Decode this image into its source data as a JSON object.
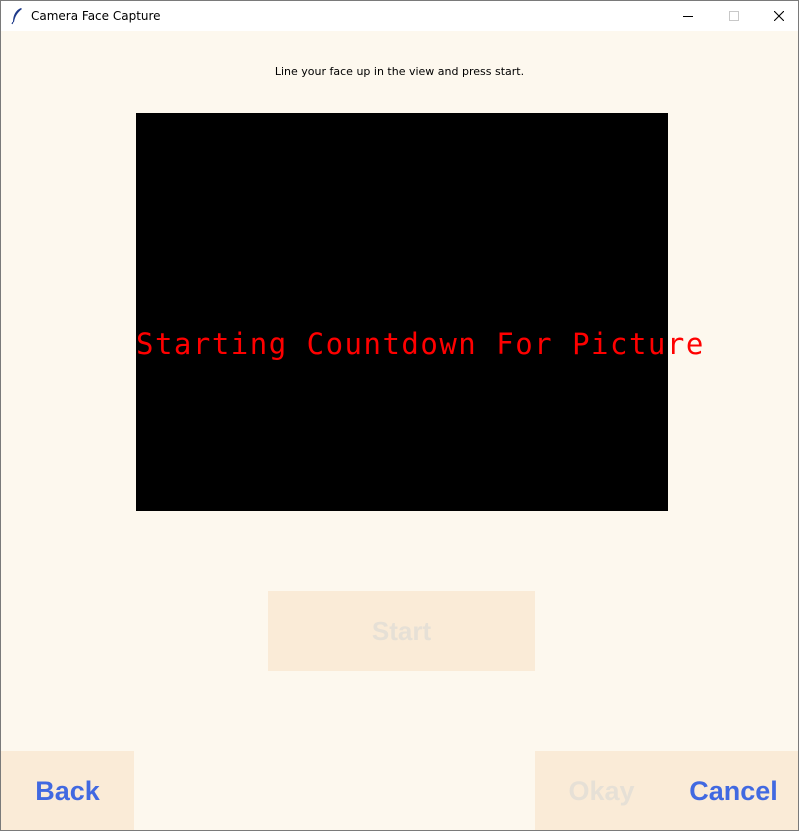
{
  "window": {
    "title": "Camera Face Capture",
    "controls": {
      "minimize_icon": "minimize-icon",
      "maximize_icon": "maximize-icon",
      "close_icon": "close-icon"
    }
  },
  "instruction": "Line your face up in the view and press start.",
  "camera": {
    "overlay_text": "Starting Countdown For Picture",
    "overlay_color": "#ff0000"
  },
  "buttons": {
    "start": {
      "label": "Start",
      "enabled": false
    },
    "back": {
      "label": "Back",
      "enabled": true
    },
    "okay": {
      "label": "Okay",
      "enabled": false
    },
    "cancel": {
      "label": "Cancel",
      "enabled": true
    }
  },
  "colors": {
    "background": "#fdf8ee",
    "button_bg": "#faebd7",
    "accent_text": "#4169e1",
    "disabled_text": "#e6e0d6"
  }
}
